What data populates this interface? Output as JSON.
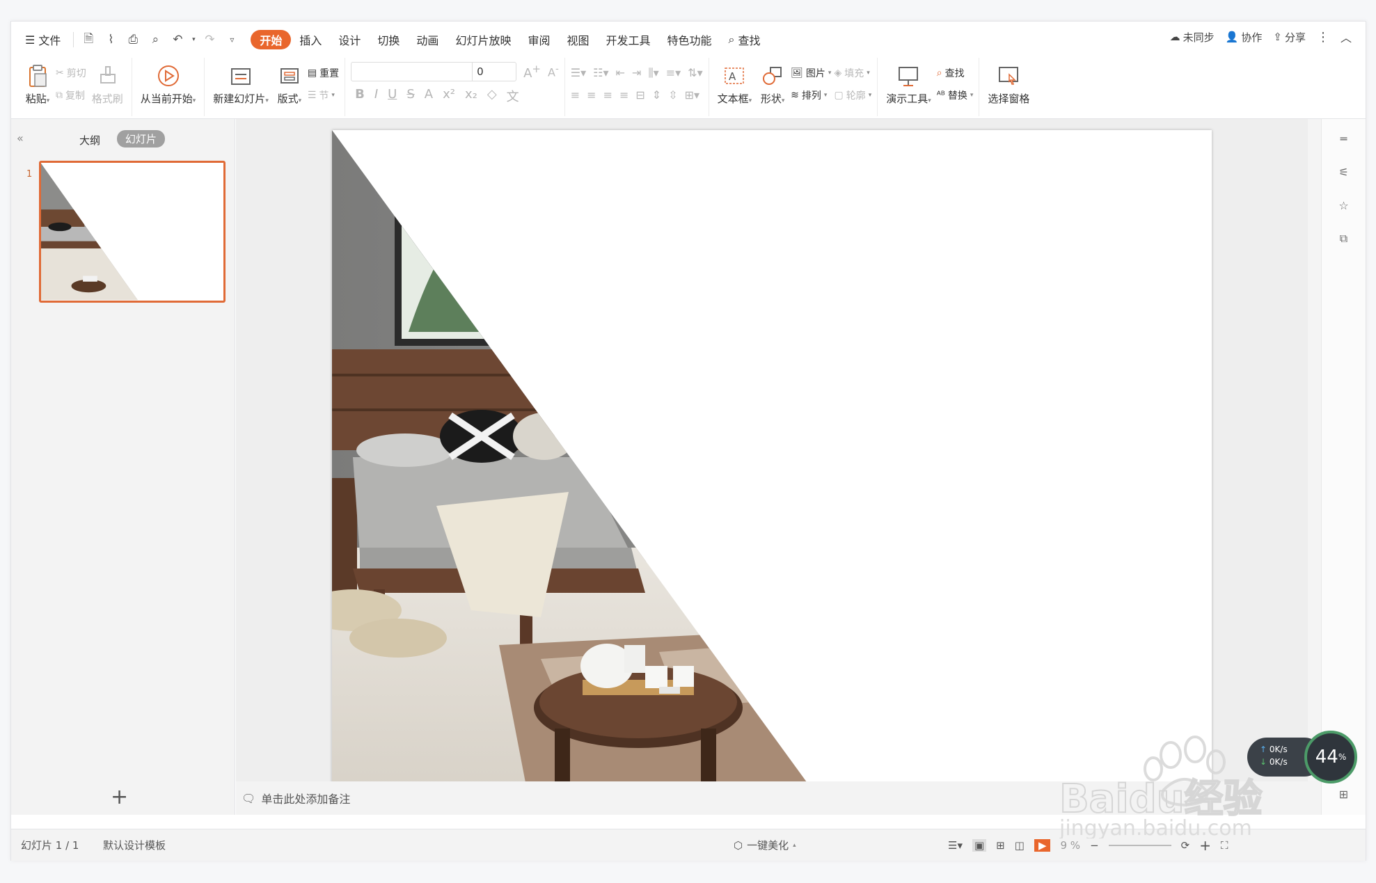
{
  "menu": {
    "file": "文件",
    "tabs": [
      "开始",
      "插入",
      "设计",
      "切换",
      "动画",
      "幻灯片放映",
      "审阅",
      "视图",
      "开发工具",
      "特色功能"
    ],
    "search": "查找",
    "unsynced": "未同步",
    "collab": "协作",
    "share": "分享"
  },
  "ribbon": {
    "paste": "粘贴",
    "cut": "剪切",
    "copy": "复制",
    "format_painter": "格式刷",
    "from_current": "从当前开始",
    "new_slide": "新建幻灯片",
    "layout": "版式",
    "reset": "重置",
    "section": "节",
    "font_size": "0",
    "textbox": "文本框",
    "shape": "形状",
    "picture": "图片",
    "fill": "填充",
    "arrange": "排列",
    "outline": "轮廓",
    "presentation_tools": "演示工具",
    "find": "查找",
    "replace": "替换",
    "selection_pane": "选择窗格"
  },
  "left": {
    "tab_outline": "大纲",
    "tab_slides": "幻灯片",
    "slide_number": "1"
  },
  "notes_placeholder": "单击此处添加备注",
  "status": {
    "slide": "幻灯片 1 / 1",
    "template": "默认设计模板",
    "beautify": "一键美化",
    "zoom": "9 %"
  },
  "network": {
    "up": "0K/s",
    "down": "0K/s",
    "percent": "44",
    "percent_unit": "%"
  },
  "watermark": {
    "line1": "Baidu经验",
    "line2": "jingyan.baidu.com"
  },
  "colors": {
    "accent": "#e9662c",
    "thumb_border": "#e06a36"
  }
}
